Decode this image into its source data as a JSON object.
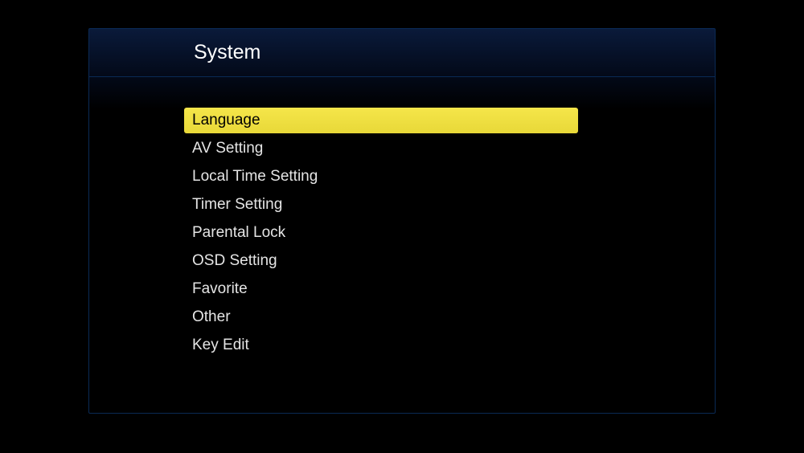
{
  "header": {
    "title": "System"
  },
  "menu": {
    "items": [
      {
        "label": "Language",
        "selected": true
      },
      {
        "label": "AV Setting",
        "selected": false
      },
      {
        "label": "Local Time Setting",
        "selected": false
      },
      {
        "label": "Timer Setting",
        "selected": false
      },
      {
        "label": "Parental Lock",
        "selected": false
      },
      {
        "label": "OSD Setting",
        "selected": false
      },
      {
        "label": "Favorite",
        "selected": false
      },
      {
        "label": "Other",
        "selected": false
      },
      {
        "label": "Key Edit",
        "selected": false
      }
    ]
  }
}
